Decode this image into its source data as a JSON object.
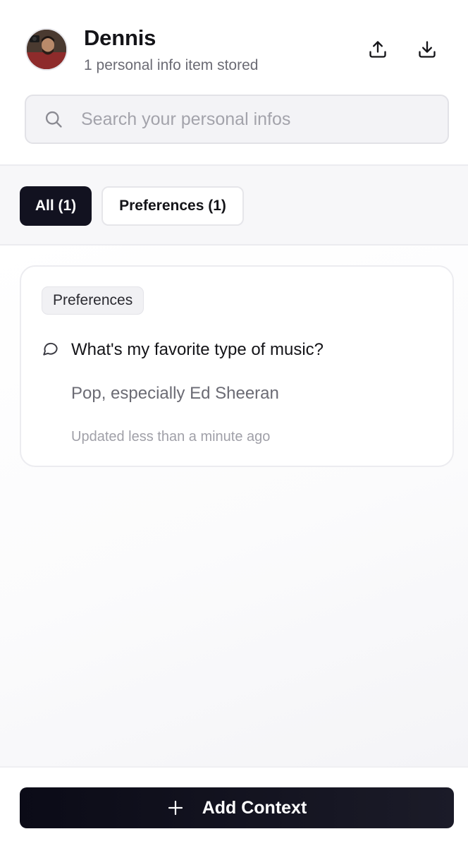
{
  "profile": {
    "name": "Dennis",
    "subtitle": "1 personal info item stored",
    "avatar_icon": "user-photo-avatar"
  },
  "toolbar": {
    "upload_icon": "upload-icon",
    "download_icon": "download-icon"
  },
  "search": {
    "placeholder": "Search your personal infos",
    "value": "",
    "icon": "search-icon"
  },
  "filters": [
    {
      "label": "All (1)",
      "active": true
    },
    {
      "label": "Preferences (1)",
      "active": false
    }
  ],
  "items": [
    {
      "category": "Preferences",
      "question": "What's my favorite type of music?",
      "answer": "Pop, especially Ed Sheeran",
      "updated": "Updated less than a minute ago",
      "icon": "chat-bubble-icon"
    }
  ],
  "footer": {
    "add_label": "Add Context",
    "add_icon": "plus-icon"
  },
  "colors": {
    "primary_dark": "#121220",
    "text_primary": "#141418",
    "text_muted": "#6b6b74",
    "border": "#ececf0"
  }
}
